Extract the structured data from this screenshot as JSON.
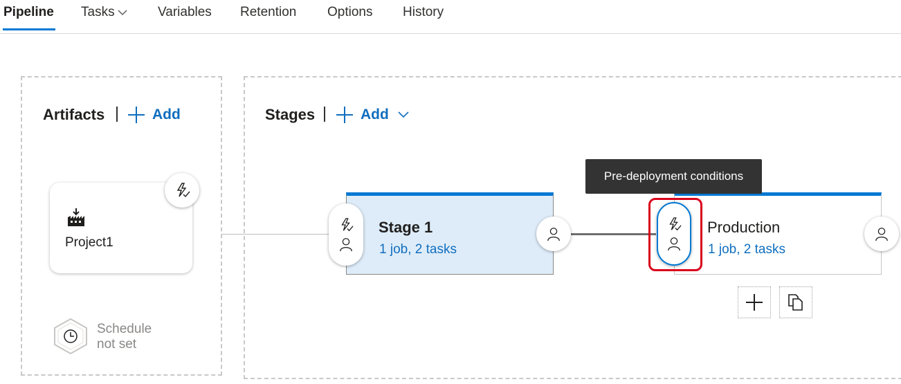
{
  "tabs": [
    {
      "label": "Pipeline"
    },
    {
      "label": "Tasks"
    },
    {
      "label": "Variables"
    },
    {
      "label": "Retention"
    },
    {
      "label": "Options"
    },
    {
      "label": "History"
    }
  ],
  "artifacts": {
    "title": "Artifacts",
    "add_label": "Add",
    "items": [
      {
        "name": "Project1",
        "icon": "build-artifact-icon"
      }
    ],
    "schedule": {
      "line1": "Schedule",
      "line2": "not set"
    }
  },
  "stages": {
    "title": "Stages",
    "add_label": "Add",
    "items": [
      {
        "name": "Stage 1",
        "summary": "1 job, 2 tasks",
        "selected": true
      },
      {
        "name": "Production",
        "summary": "1 job, 2 tasks",
        "selected": false
      }
    ]
  },
  "tooltip": {
    "text": "Pre-deployment conditions"
  },
  "colors": {
    "accent": "#0078d4",
    "link": "#106ebe",
    "selected_bg": "#deecf9",
    "highlight": "#d9001b",
    "tooltip_bg": "#333333"
  }
}
